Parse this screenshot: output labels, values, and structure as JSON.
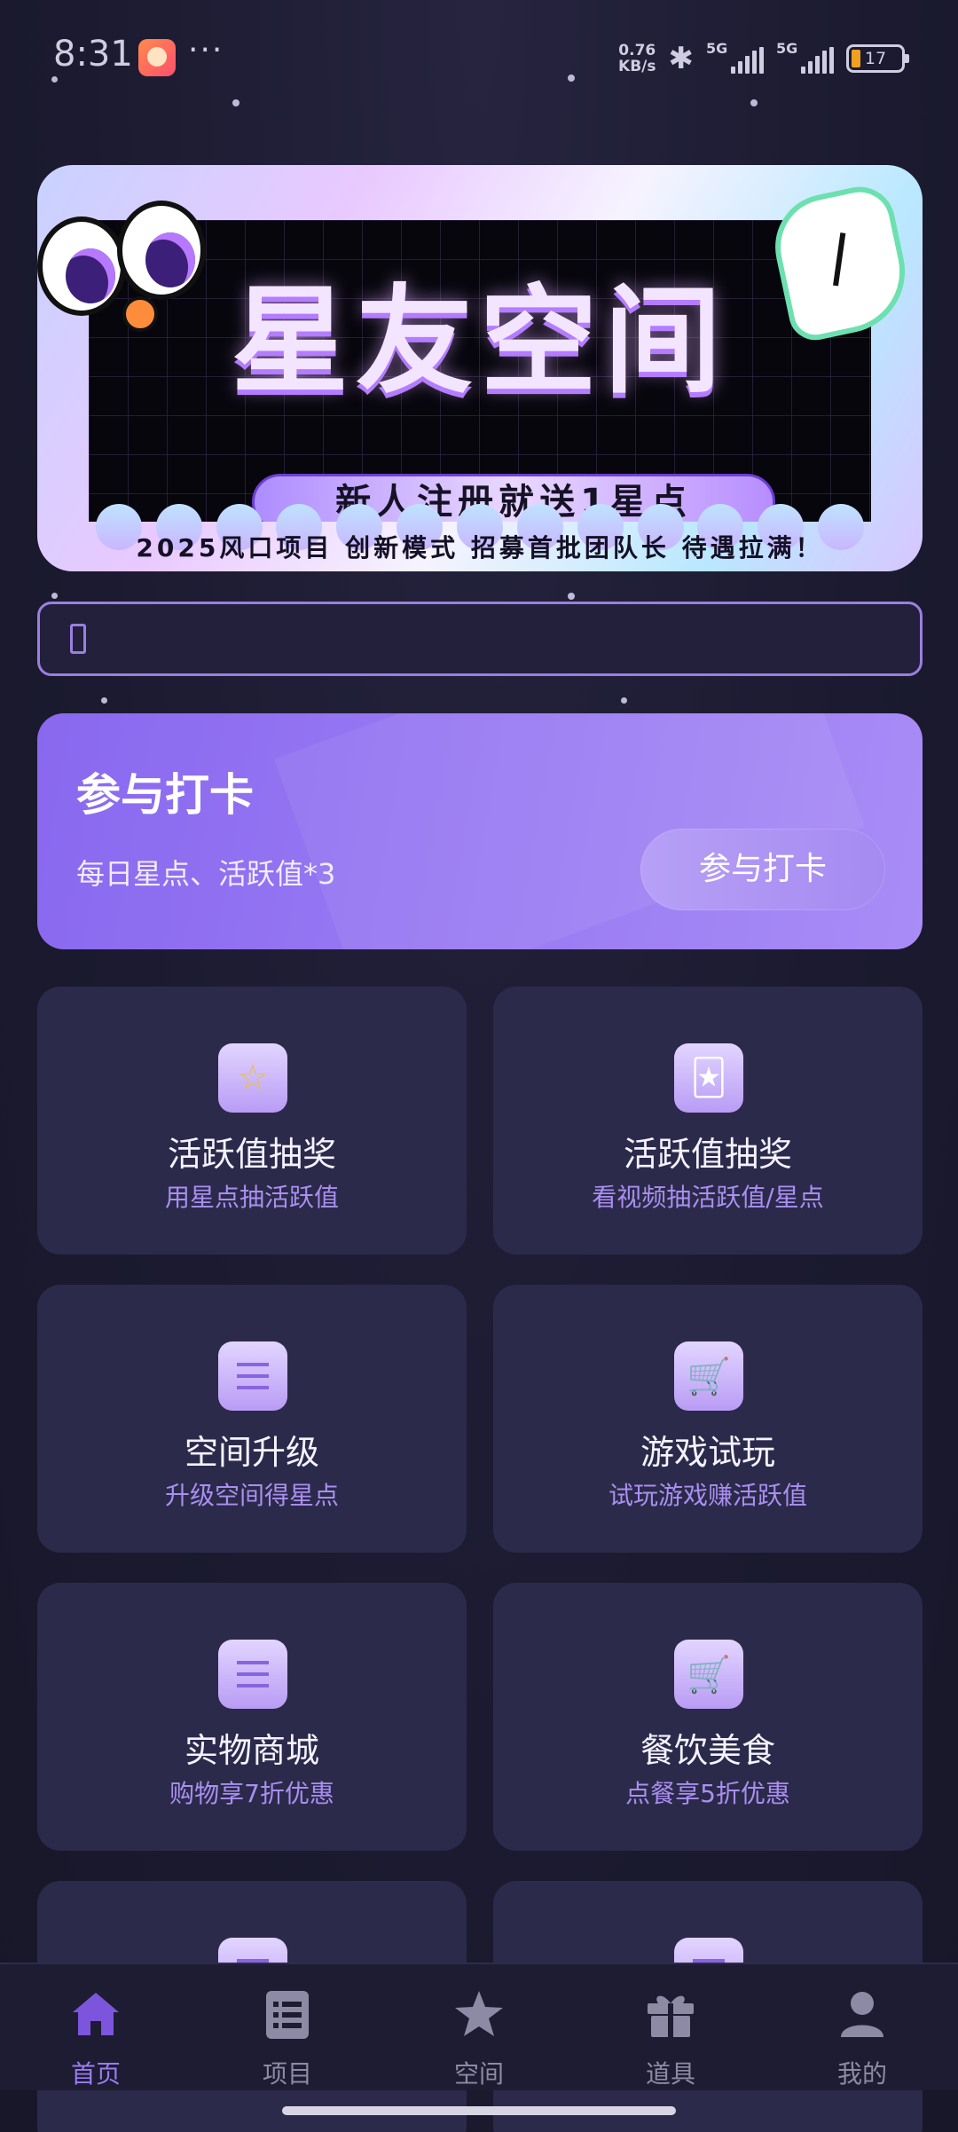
{
  "status_bar": {
    "time": "8:31",
    "more": "···",
    "net_speed_value": "0.76",
    "net_speed_unit": "KB/s",
    "bluetooth_icon": "bluetooth-icon",
    "signal1_label": "5G",
    "signal2_label": "5G",
    "battery_level": "17"
  },
  "banner": {
    "title": "星友空间",
    "pill_text": "新人注册就送1星点",
    "slogan": "2025风口项目 创新模式 招募首批团队长 待遇拉满！"
  },
  "search": {
    "value": "",
    "placeholder": ""
  },
  "checkin": {
    "title": "参与打卡",
    "subtitle": "每日星点、活跃值*3",
    "button_label": "参与打卡"
  },
  "features": [
    {
      "icon": "star-icon",
      "title": "活跃值抽奖",
      "subtitle": "用星点抽活跃值"
    },
    {
      "icon": "joker-card-icon",
      "title": "活跃值抽奖",
      "subtitle": "看视频抽活跃值/星点"
    },
    {
      "icon": "list-icon",
      "title": "空间升级",
      "subtitle": "升级空间得星点"
    },
    {
      "icon": "cart-icon",
      "title": "游戏试玩",
      "subtitle": "试玩游戏赚活跃值"
    },
    {
      "icon": "list-icon",
      "title": "实物商城",
      "subtitle": "购物享7折优惠"
    },
    {
      "icon": "cart-icon",
      "title": "餐饮美食",
      "subtitle": "点餐享5折优惠"
    }
  ],
  "tabs": [
    {
      "icon": "home-icon",
      "label": "首页",
      "active": true
    },
    {
      "icon": "list-icon",
      "label": "项目",
      "active": false
    },
    {
      "icon": "star-icon",
      "label": "空间",
      "active": false
    },
    {
      "icon": "gift-icon",
      "label": "道具",
      "active": false
    },
    {
      "icon": "user-icon",
      "label": "我的",
      "active": false
    }
  ],
  "colors": {
    "background": "#1d1c33",
    "accent": "#9a7cf0",
    "card": "#2c2a4a",
    "checkin_gradient_start": "#8968ef",
    "checkin_gradient_end": "#a98cf6"
  }
}
